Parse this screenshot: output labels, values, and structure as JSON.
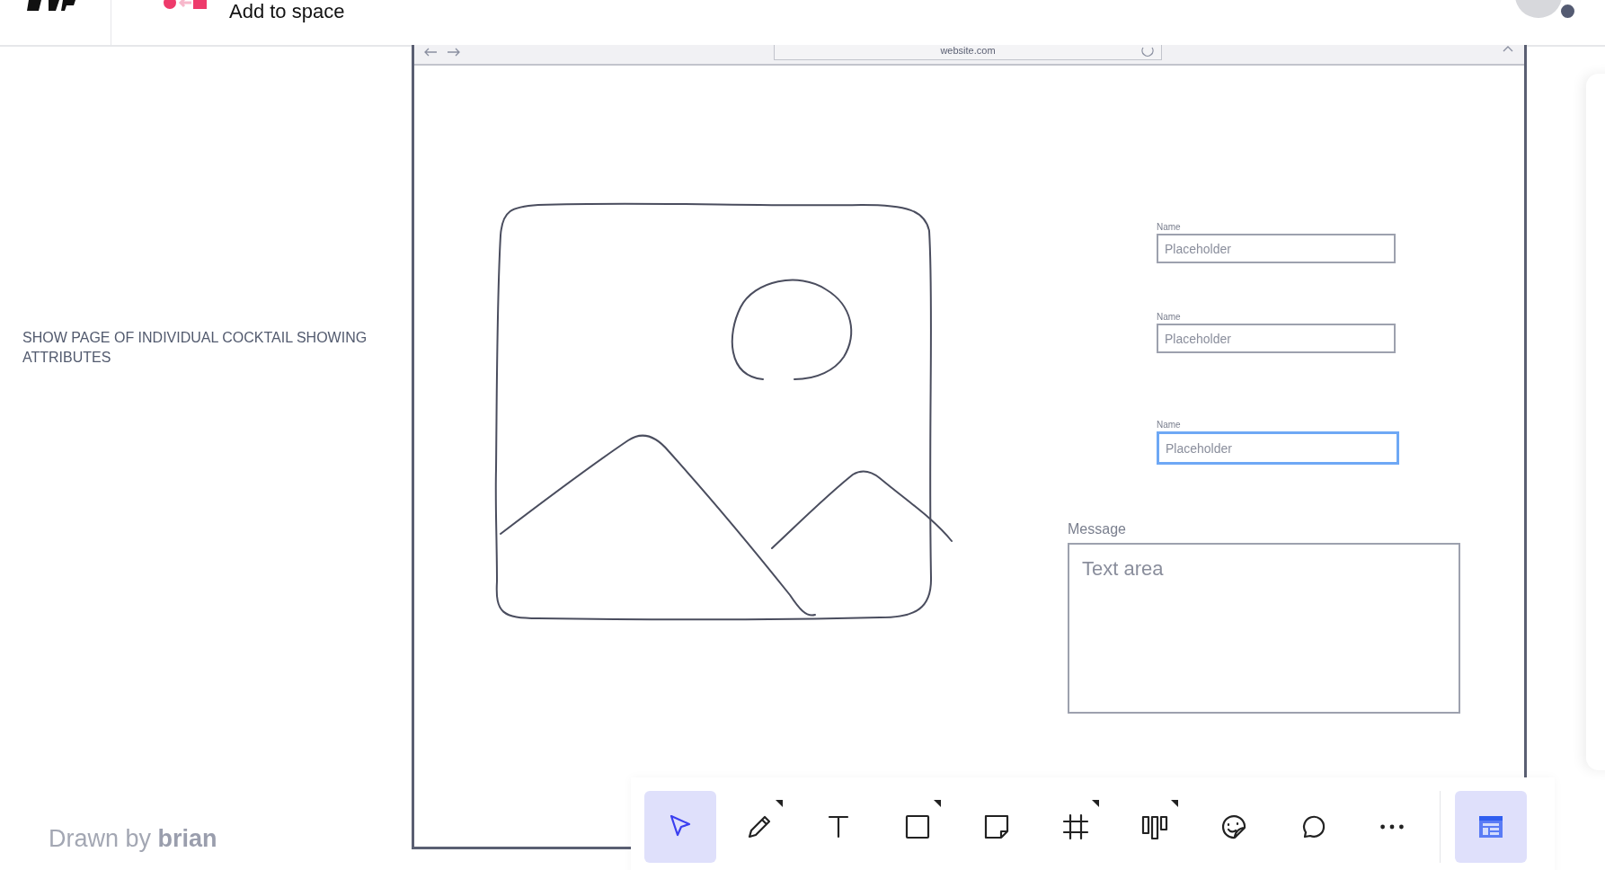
{
  "header": {
    "action": "Add to space"
  },
  "note": "SHOW PAGE OF INDIVIDUAL COCKTAIL SHOWING ATTRIBUTES",
  "browser": {
    "url": "website.com"
  },
  "fields": [
    {
      "label": "Name",
      "placeholder": "Placeholder",
      "focused": false
    },
    {
      "label": "Name",
      "placeholder": "Placeholder",
      "focused": false
    },
    {
      "label": "Name",
      "placeholder": "Placeholder",
      "focused": true
    }
  ],
  "message": {
    "label": "Message",
    "placeholder": "Text area"
  },
  "credit": "Drawn by **brian**",
  "tools": [
    {
      "kind": "select",
      "selected": true,
      "has_menu": false
    },
    {
      "kind": "pen",
      "selected": false,
      "has_menu": true
    },
    {
      "kind": "text",
      "selected": false,
      "has_menu": false
    },
    {
      "kind": "shape",
      "selected": false,
      "has_menu": true
    },
    {
      "kind": "sticky",
      "selected": false,
      "has_menu": false
    },
    {
      "kind": "frame",
      "selected": false,
      "has_menu": true
    },
    {
      "kind": "columns",
      "selected": false,
      "has_menu": true
    },
    {
      "kind": "sticker",
      "selected": false,
      "has_menu": false
    },
    {
      "kind": "comment",
      "selected": false,
      "has_menu": false
    },
    {
      "kind": "more",
      "selected": false,
      "has_menu": false
    }
  ],
  "side_tool": {
    "kind": "templates",
    "selected": true
  }
}
